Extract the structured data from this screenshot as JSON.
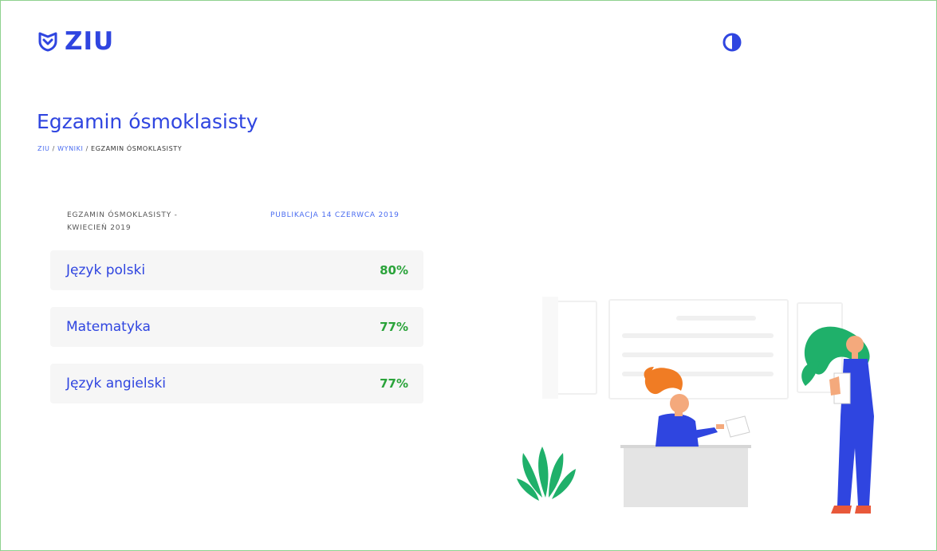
{
  "brand": {
    "name": "ZIU",
    "color": "#2f45e0"
  },
  "header": {
    "theme_toggle_icon": "contrast-icon"
  },
  "page": {
    "title": "Egzamin ósmoklasisty"
  },
  "breadcrumb": {
    "items": [
      {
        "label": "ZIU",
        "link": true
      },
      {
        "label": "WYNIKI",
        "link": true
      },
      {
        "label": "EGZAMIN ÓSMOKLASISTY",
        "link": false
      }
    ],
    "separator": " / "
  },
  "results": {
    "exam_name": "EGZAMIN ÓSMOKLASISTY - KWIECIEŃ 2019",
    "publication": "PUBLIKACJA 14 CZERWCA 2019",
    "rows": [
      {
        "subject": "Język polski",
        "score": "80%"
      },
      {
        "subject": "Matematyka",
        "score": "77%"
      },
      {
        "subject": "Język angielski",
        "score": "77%"
      }
    ]
  },
  "colors": {
    "accent": "#2f45e0",
    "link": "#4a6cf0",
    "score": "#2aa33a",
    "row_bg": "#f6f6f6"
  }
}
